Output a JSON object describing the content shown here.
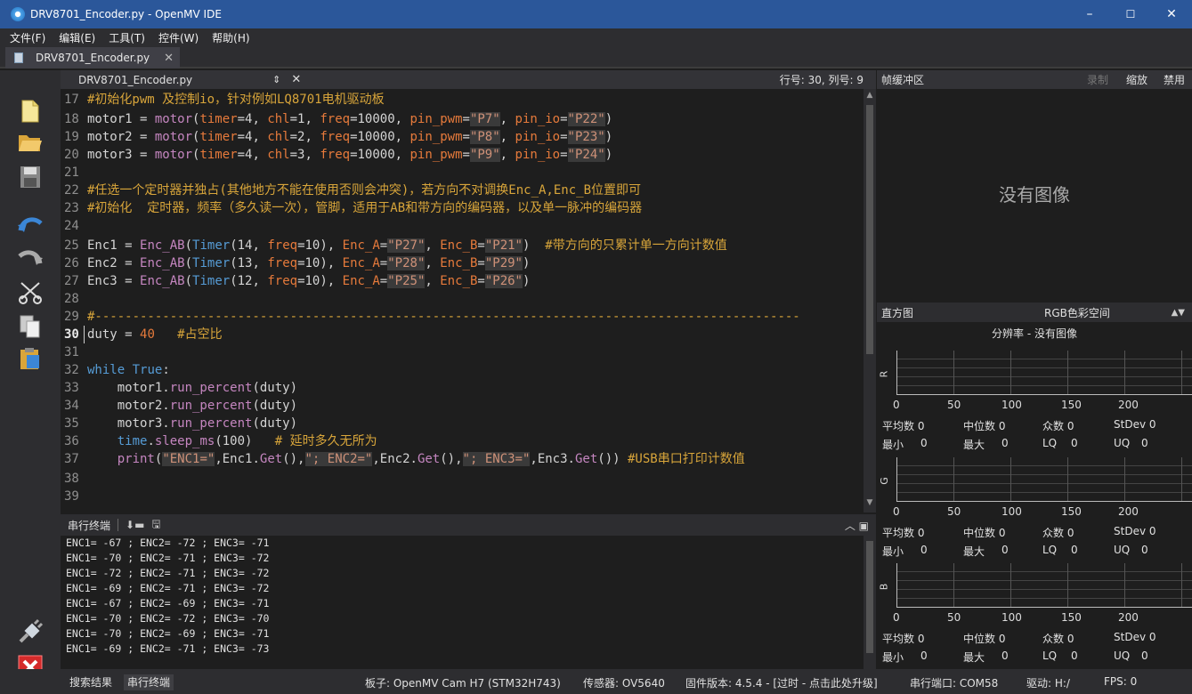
{
  "window": {
    "title": "DRV8701_Encoder.py - OpenMV IDE",
    "minimize": "–",
    "maximize": "☐",
    "close": "✕"
  },
  "menu": [
    "文件(F)",
    "编辑(E)",
    "工具(T)",
    "控件(W)",
    "帮助(H)"
  ],
  "tab": {
    "name": "DRV8701_Encoder.py",
    "close": "✕"
  },
  "editor": {
    "file": "DRV8701_Encoder.py",
    "arrows": "⇕",
    "close": "✕",
    "position": "行号: 30, 列号: 9",
    "current_line": "30"
  },
  "terminal": {
    "title": "串行终端",
    "lines": [
      "ENC1= -67 ; ENC2= -72 ; ENC3= -71",
      "ENC1= -70 ; ENC2= -71 ; ENC3= -72",
      "ENC1= -72 ; ENC2= -71 ; ENC3= -72",
      "ENC1= -69 ; ENC2= -71 ; ENC3= -72",
      "ENC1= -67 ; ENC2= -69 ; ENC3= -71",
      "ENC1= -70 ; ENC2= -72 ; ENC3= -70",
      "ENC1= -70 ; ENC2= -69 ; ENC3= -71",
      "ENC1= -69 ; ENC2= -71 ; ENC3= -73"
    ]
  },
  "framebuffer": {
    "title": "帧缓冲区",
    "record": "录制",
    "zoom": "缩放",
    "disable": "禁用",
    "no_image": "没有图像"
  },
  "histogram": {
    "title": "直方图",
    "colorspace": "RGB色彩空间",
    "resolution": "分辨率 - 没有图像",
    "channels": [
      "R",
      "G",
      "B"
    ],
    "ticks": [
      "0",
      "50",
      "100",
      "150",
      "200"
    ],
    "stats_row1": [
      "平均数 0",
      "中位数 0",
      "众数 0",
      "StDev 0"
    ],
    "stats_row2": [
      "最小",
      "0",
      "最大",
      "0",
      "LQ",
      "0",
      "UQ",
      "0"
    ]
  },
  "statusbar": {
    "search_results": "搜索结果",
    "serial_terminal": "串行终端",
    "board": "板子: OpenMV Cam H7 (STM32H743)",
    "sensor": "传感器: OV5640",
    "firmware": "固件版本: 4.5.4 - [过时 - 点击此处升级]",
    "port": "串行端口: COM58",
    "drive": "驱动: H:/",
    "fps": "FPS: 0"
  },
  "colors": {
    "titlebar": "#2b579a",
    "background": "#1e1e1e",
    "panel": "#2d2d30",
    "keyword": "#569cd6",
    "function": "#c586c0",
    "param": "#e67a3b",
    "string": "#ce9178",
    "comment": "#d8a53a"
  }
}
